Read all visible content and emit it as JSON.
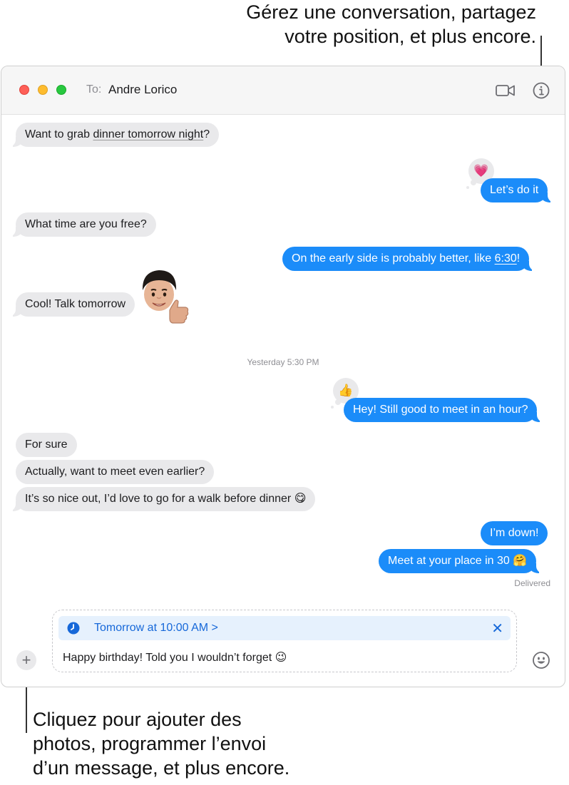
{
  "callouts": {
    "top_line1": "Gérez une conversation, partagez",
    "top_line2": "votre position, et plus encore.",
    "bottom_line1": "Cliquez pour ajouter des",
    "bottom_line2": "photos, programmer l’envoi",
    "bottom_line3": "d’un message, et plus encore."
  },
  "header": {
    "to_label": "To:",
    "recipient": "Andre Lorico",
    "video_icon": "video-camera-icon",
    "info_icon": "info-icon"
  },
  "messages": {
    "m1": {
      "pre": "Want to grab ",
      "link": "dinner tomorrow night",
      "post": "?"
    },
    "m2": "Let’s do it",
    "m2_tapback": "💗",
    "m3": "What time are you free?",
    "m4": {
      "pre": "On the early side is probably better, like ",
      "link": "6:30",
      "post": "!"
    },
    "m5": "Cool! Talk tomorrow",
    "memoji": "🧑🏻👍",
    "timestamp": "Yesterday 5:30 PM",
    "m6": "Hey! Still good to meet in an hour?",
    "m6_tapback": "👍",
    "m7": "For sure",
    "m8": "Actually, want to meet even earlier?",
    "m9": "It’s so nice out, I’d love to go for a walk before dinner 😋",
    "m10": "I’m down!",
    "m11": "Meet at your place in 30 🤗",
    "delivered": "Delivered"
  },
  "composer": {
    "add_label": "+",
    "schedule_text": "Tomorrow at 10:00 AM >",
    "schedule_close": "✕",
    "draft_text": "Happy birthday! Told you I wouldn’t forget 😉",
    "emoji_icon": "smiley-face-icon"
  },
  "colors": {
    "outgoing_bubble": "#1b8cf9",
    "incoming_bubble": "#e9e9eb",
    "schedule_accent": "#1668d9"
  }
}
